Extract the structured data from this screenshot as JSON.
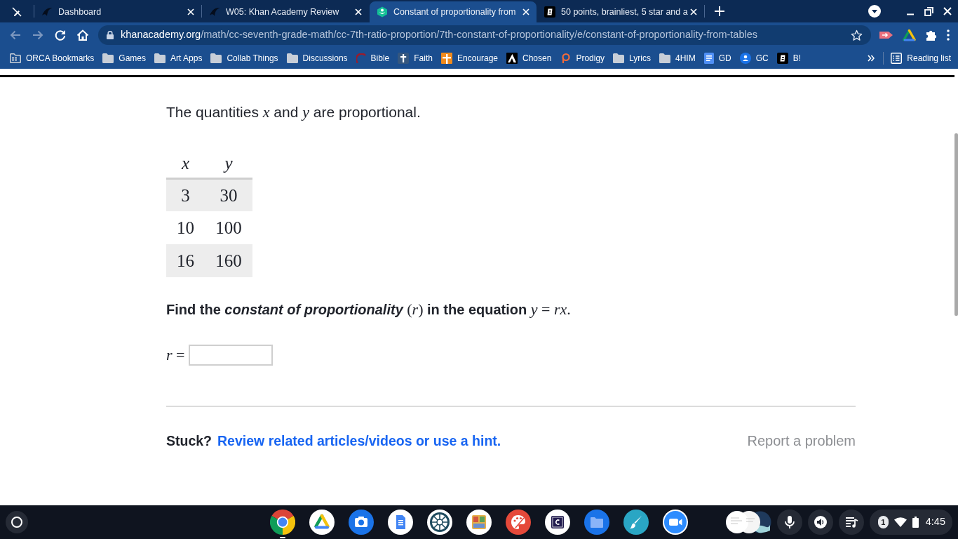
{
  "browser": {
    "pinned_tab": {
      "selected": false
    },
    "tabs": [
      {
        "kind": "swoosh",
        "title": "Dashboard",
        "selected": false
      },
      {
        "kind": "swoosh",
        "title": "W05: Khan Academy Review",
        "selected": false
      },
      {
        "kind": "hexleaf",
        "title": "Constant of proportionality from",
        "selected": true
      },
      {
        "kind": "tile",
        "title": "50 points, brainliest, 5 star and a",
        "selected": false
      }
    ],
    "back": {
      "disabled": true
    },
    "forward": {
      "disabled": true
    },
    "address": {
      "host": "khanacademy.org",
      "path": "/math/cc-seventh-grade-math/cc-7th-ratio-proportion/7th-constant-of-proportionality/e/constant-of-proportionality-from-tables"
    },
    "bookmarks": [
      {
        "kind": "grid-folder",
        "title": "ORCA Bookmarks"
      },
      {
        "kind": "folder",
        "title": "Games"
      },
      {
        "kind": "folder",
        "title": "Art Apps"
      },
      {
        "kind": "folder",
        "title": "Collab Things"
      },
      {
        "kind": "folder",
        "title": "Discussions"
      },
      {
        "kind": "arc",
        "title": "Bible"
      },
      {
        "kind": "cross",
        "title": "Faith"
      },
      {
        "kind": "cross-tile",
        "title": "Encourage"
      },
      {
        "kind": "peak-tile",
        "title": "Chosen"
      },
      {
        "kind": "swirl",
        "title": "Prodigy"
      },
      {
        "kind": "folder",
        "title": "Lyrics"
      },
      {
        "kind": "folder",
        "title": "4HIM"
      },
      {
        "kind": "document",
        "title": "GD"
      },
      {
        "kind": "person",
        "title": "GC"
      },
      {
        "kind": "tile",
        "title": "B!"
      }
    ],
    "reading_list": "Reading list"
  },
  "exercise": {
    "intro": [
      {
        "kind": "text",
        "text": "The quantities "
      },
      {
        "kind": "math",
        "text": "x"
      },
      {
        "kind": "text",
        "text": " and "
      },
      {
        "kind": "math",
        "text": "y"
      },
      {
        "kind": "text",
        "text": " are proportional."
      }
    ],
    "table": {
      "columns": [
        "x",
        "y"
      ],
      "rows": [
        [
          "3",
          "30"
        ],
        [
          "10",
          "100"
        ],
        [
          "16",
          "160"
        ]
      ]
    },
    "prompt": [
      {
        "kind": "text",
        "text": "Find the "
      },
      {
        "kind": "term",
        "text": "constant of proportionality"
      },
      {
        "kind": "math",
        "text": " (r)"
      },
      {
        "kind": "text",
        "text": " in the equation "
      },
      {
        "kind": "math",
        "text": "y = rx."
      }
    ],
    "answer": {
      "label": "r ="
    },
    "stuck": {
      "label": "Stuck?",
      "link": "Review related articles/videos or use a hint."
    },
    "report": "Report a problem"
  },
  "shelf": {
    "apps": [
      {
        "kind": "chrome",
        "running": true
      },
      {
        "kind": "drive",
        "running": false
      },
      {
        "kind": "camera",
        "running": false
      },
      {
        "kind": "docs",
        "running": false
      },
      {
        "kind": "wheel",
        "running": false
      },
      {
        "kind": "collage",
        "running": false
      },
      {
        "kind": "palette",
        "running": false
      },
      {
        "kind": "square",
        "running": false
      },
      {
        "kind": "files",
        "running": false
      },
      {
        "kind": "brush",
        "running": false
      },
      {
        "kind": "video",
        "running": false
      }
    ],
    "notifications": "1",
    "time": "4:45"
  }
}
